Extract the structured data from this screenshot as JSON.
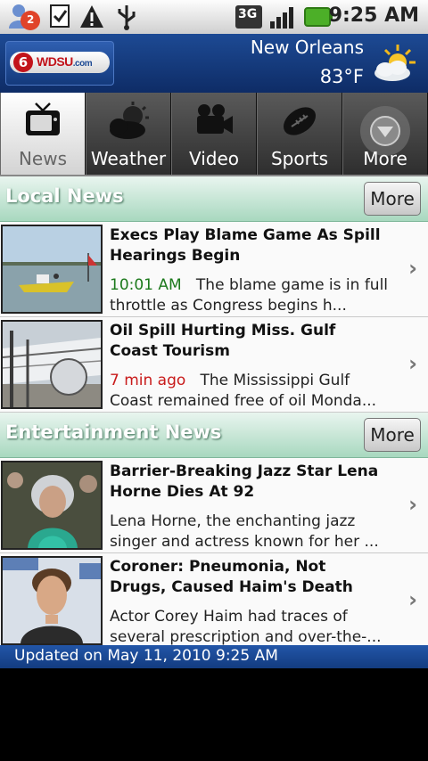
{
  "status_bar": {
    "notification_count": "2",
    "network": "3G",
    "time": "9:25 AM"
  },
  "header": {
    "logo_text": "WDSU",
    "logo_suffix": ".com",
    "logo_digit": "6",
    "city": "New Orleans",
    "temperature": "83°F",
    "weather_icon": "partly-sunny-icon"
  },
  "tabs": [
    {
      "label": "News",
      "icon": "tv-icon",
      "active": true
    },
    {
      "label": "Weather",
      "icon": "cloud-sun-icon",
      "active": false
    },
    {
      "label": "Video",
      "icon": "video-camera-icon",
      "active": false
    },
    {
      "label": "Sports",
      "icon": "football-icon",
      "active": false
    },
    {
      "label": "More",
      "icon": "chevron-down-circle-icon",
      "active": false
    }
  ],
  "sections": [
    {
      "title": "Local News",
      "more_label": "More",
      "items": [
        {
          "title": "Execs Play Blame Game As Spill Hearings Begin",
          "timestamp": "10:01 AM",
          "summary": "The blame game is in full throttle as Congress begins h..."
        },
        {
          "title": "Oil Spill Hurting Miss. Gulf Coast Tourism",
          "timestamp": "7 min ago",
          "summary": "The Mississippi Gulf Coast remained free of oil Monda..."
        }
      ]
    },
    {
      "title": "Entertainment News",
      "more_label": "More",
      "items": [
        {
          "title": "Barrier-Breaking Jazz Star Lena Horne Dies At 92",
          "summary": "Lena Horne, the enchanting jazz singer and actress known for her ..."
        },
        {
          "title": "Coroner: Pneumonia, Not Drugs, Caused Haim's Death",
          "summary": "Actor Corey Haim had traces of several prescription and over-the-..."
        }
      ]
    }
  ],
  "footer": {
    "updated_text": "Updated on May 11, 2010 9:25 AM"
  },
  "colors": {
    "header_blue": "#1d4a94",
    "section_green": "#a8d8bf",
    "timestamp_green": "#1d7a1d",
    "timestamp_red": "#c81a1a"
  }
}
